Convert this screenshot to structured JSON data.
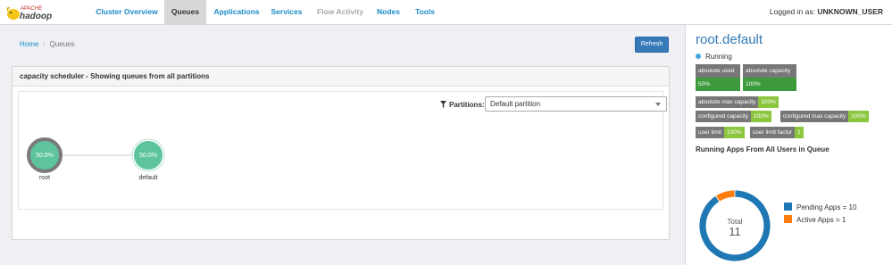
{
  "nav": {
    "logo": {
      "top": "APACHE",
      "bottom": "hadoop"
    },
    "items": [
      {
        "label": "Cluster Overview",
        "state": "normal"
      },
      {
        "label": "Queues",
        "state": "active"
      },
      {
        "label": "Applications",
        "state": "normal"
      },
      {
        "label": "Services",
        "state": "normal"
      },
      {
        "label": "Flow Activity",
        "state": "disabled"
      },
      {
        "label": "Nodes",
        "state": "normal"
      },
      {
        "label": "Tools",
        "state": "normal"
      }
    ],
    "login_prefix": "Logged in as:",
    "login_user": "UNKNOWN_USER"
  },
  "breadcrumb": {
    "home": "Home",
    "current": "Queues",
    "separator": "/"
  },
  "refresh_label": "Refresh",
  "panel": {
    "title": "capacity scheduler - Showing queues from all partitions",
    "partitions_label": "Partitions:",
    "partition_selected": "Default partition"
  },
  "tree": {
    "nodes": [
      {
        "name": "root",
        "capacity": "50.0%",
        "selected": false
      },
      {
        "name": "default",
        "capacity": "50.0%",
        "selected": true
      }
    ]
  },
  "queue": {
    "title": "root.default",
    "status": "Running",
    "absolute_used": {
      "label": "absolute used",
      "value": "50%"
    },
    "absolute_capacity": {
      "label": "absolute capacity",
      "value": "100%"
    },
    "absolute_max_capacity": {
      "label": "absolute max capacity",
      "value": "100%"
    },
    "configured_capacity": {
      "label": "configured capacity",
      "value": "100%"
    },
    "configured_max_capacity": {
      "label": "configured max capacity",
      "value": "100%"
    },
    "user_limit": {
      "label": "user limit",
      "value": "100%"
    },
    "user_limit_factor": {
      "label": "user limit factor",
      "value": "1"
    }
  },
  "apps": {
    "title": "Running Apps From All Users in Queue",
    "total_label": "Total",
    "total": "11",
    "legend": [
      {
        "label": "Pending Apps = 10",
        "value": 10,
        "color": "#1f77b4"
      },
      {
        "label": "Active Apps = 1",
        "value": 1,
        "color": "#ff7f0e"
      }
    ]
  },
  "colors": {
    "link": "#1b8bc9",
    "queue_title": "#337ab7",
    "node_fill": "#5dc49c",
    "node_ring": "#7a7a7a",
    "used_value": "#3c9a3c",
    "metric_value": "#8cc63f"
  }
}
